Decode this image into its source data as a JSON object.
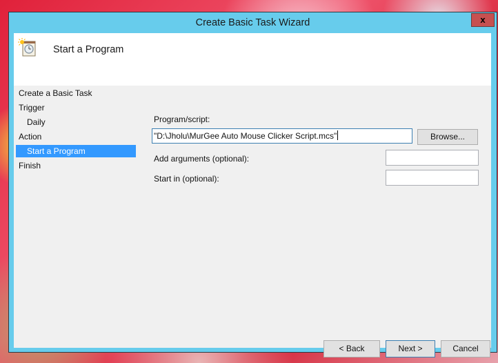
{
  "window": {
    "title": "Create Basic Task Wizard",
    "close_label": "x"
  },
  "header": {
    "title": "Start a Program",
    "icon": "task-scheduler-clock-icon"
  },
  "nav": {
    "items": [
      {
        "label": "Create a Basic Task",
        "indent": false,
        "selected": false
      },
      {
        "label": "Trigger",
        "indent": false,
        "selected": false
      },
      {
        "label": "Daily",
        "indent": true,
        "selected": false
      },
      {
        "label": "Action",
        "indent": false,
        "selected": false
      },
      {
        "label": "Start a Program",
        "indent": true,
        "selected": true
      },
      {
        "label": "Finish",
        "indent": false,
        "selected": false
      }
    ]
  },
  "form": {
    "program_label": "Program/script:",
    "program_value": "\"D:\\Jholu\\MurGee Auto Mouse Clicker Script.mcs\"",
    "browse_label": "Browse...",
    "arguments_label": "Add arguments (optional):",
    "arguments_value": "",
    "start_in_label": "Start in (optional):",
    "start_in_value": ""
  },
  "footer": {
    "back_label": "< Back",
    "next_label": "Next >",
    "cancel_label": "Cancel"
  },
  "colors": {
    "frame": "#67ccec",
    "close": "#c75050",
    "selection": "#3399ff"
  }
}
